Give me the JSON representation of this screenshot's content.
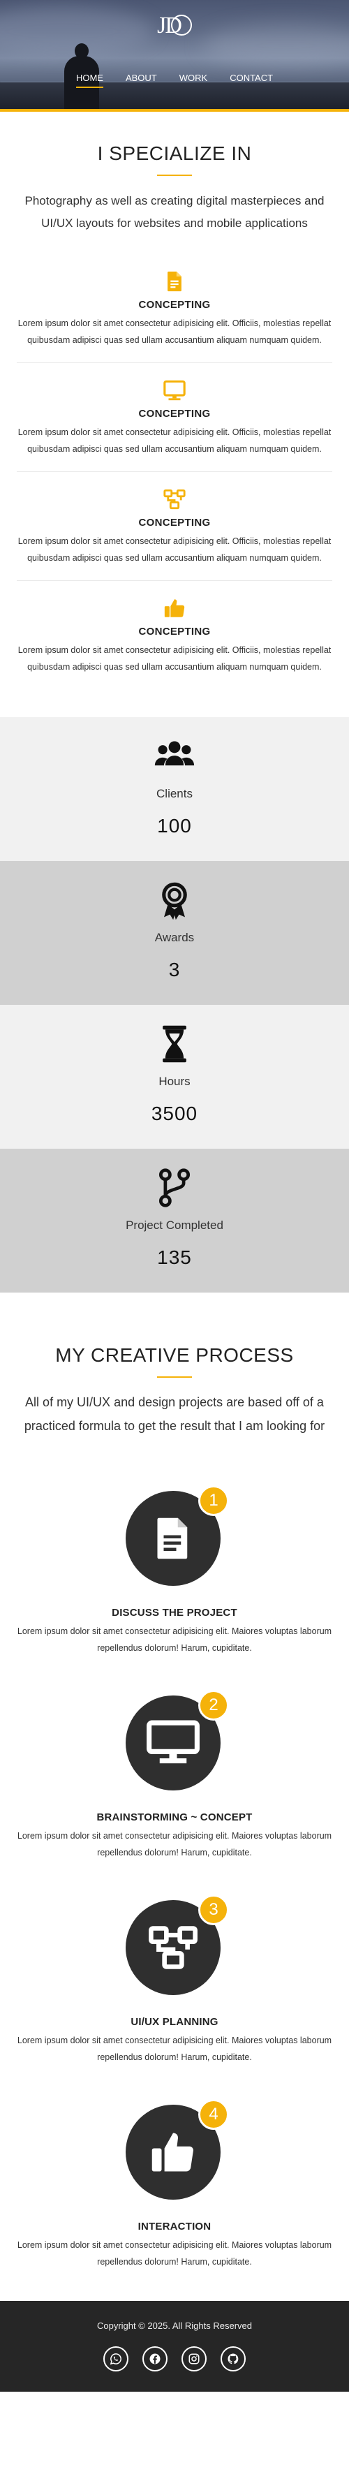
{
  "header": {
    "logo": "JD",
    "nav": [
      "HOME",
      "ABOUT",
      "WORK",
      "CONTACT"
    ],
    "active": "HOME"
  },
  "specialize": {
    "title": "I SPECIALIZE IN",
    "subtitle": "Photography as well as creating digital masterpieces and UI/UX layouts for websites and mobile applications",
    "items": [
      {
        "icon": "document-icon",
        "title": "CONCEPTING",
        "text": "Lorem ipsum dolor sit amet consectetur adipisicing elit. Officiis, molestias repellat quibusdam adipisci quas sed ullam accusantium aliquam numquam quidem."
      },
      {
        "icon": "monitor-icon",
        "title": "CONCEPTING",
        "text": "Lorem ipsum dolor sit amet consectetur adipisicing elit. Officiis, molestias repellat quibusdam adipisci quas sed ullam accusantium aliquam numquam quidem."
      },
      {
        "icon": "flow-icon",
        "title": "CONCEPTING",
        "text": "Lorem ipsum dolor sit amet consectetur adipisicing elit. Officiis, molestias repellat quibusdam adipisci quas sed ullam accusantium aliquam numquam quidem."
      },
      {
        "icon": "thumbs-up-icon",
        "title": "CONCEPTING",
        "text": "Lorem ipsum dolor sit amet consectetur adipisicing elit. Officiis, molestias repellat quibusdam adipisci quas sed ullam accusantium aliquam numquam quidem."
      }
    ]
  },
  "stats": [
    {
      "icon": "users-icon",
      "label": "Clients",
      "value": "100"
    },
    {
      "icon": "award-icon",
      "label": "Awards",
      "value": "3"
    },
    {
      "icon": "hourglass-icon",
      "label": "Hours",
      "value": "3500"
    },
    {
      "icon": "code-branch-icon",
      "label": "Project Completed",
      "value": "135"
    }
  ],
  "process": {
    "title": "MY CREATIVE PROCESS",
    "subtitle": "All of my UI/UX and design projects are based off of a practiced formula to get the result that I am looking for",
    "steps": [
      {
        "number": "1",
        "icon": "document-icon",
        "title": "DISCUSS THE PROJECT",
        "text": "Lorem ipsum dolor sit amet consectetur adipisicing elit. Maiores voluptas laborum repellendus dolorum! Harum, cupiditate."
      },
      {
        "number": "2",
        "icon": "monitor-icon",
        "title": "BRAINSTORMING ~ CONCEPT",
        "text": "Lorem ipsum dolor sit amet consectetur adipisicing elit. Maiores voluptas laborum repellendus dolorum! Harum, cupiditate."
      },
      {
        "number": "3",
        "icon": "flow-icon",
        "title": "UI/UX PLANNING",
        "text": "Lorem ipsum dolor sit amet consectetur adipisicing elit. Maiores voluptas laborum repellendus dolorum! Harum, cupiditate."
      },
      {
        "number": "4",
        "icon": "thumbs-up-icon",
        "title": "INTERACTION",
        "text": "Lorem ipsum dolor sit amet consectetur adipisicing elit. Maiores voluptas laborum repellendus dolorum! Harum, cupiditate."
      }
    ]
  },
  "footer": {
    "copyright": "Copyright © 2025. All Rights Reserved",
    "socials": [
      "whatsapp-icon",
      "facebook-icon",
      "instagram-icon",
      "github-icon"
    ]
  },
  "colors": {
    "accent": "#f5b20a",
    "dark": "#2f2f2f",
    "footer": "#262626"
  }
}
